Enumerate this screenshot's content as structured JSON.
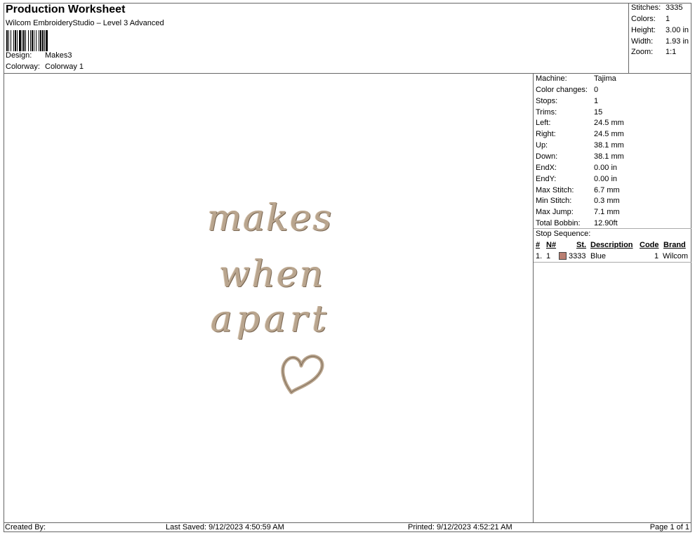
{
  "header": {
    "title": "Production Worksheet",
    "subtitle": "Wilcom EmbroideryStudio – Level 3 Advanced",
    "design_label": "Design:",
    "design_value": "Makes3",
    "colorway_label": "Colorway:",
    "colorway_value": "Colorway 1"
  },
  "summary": [
    {
      "label": "Stitches:",
      "value": "3335"
    },
    {
      "label": "Colors:",
      "value": "1"
    },
    {
      "label": "Height:",
      "value": "3.00 in"
    },
    {
      "label": "Width:",
      "value": "1.93 in"
    },
    {
      "label": "Zoom:",
      "value": "1:1"
    }
  ],
  "machine_info": [
    {
      "label": "Machine:",
      "value": "Tajima"
    },
    {
      "label": "Color changes:",
      "value": "0"
    },
    {
      "label": "Stops:",
      "value": "1"
    },
    {
      "label": "Trims:",
      "value": "15"
    },
    {
      "label": "Left:",
      "value": "24.5 mm"
    },
    {
      "label": "Right:",
      "value": "24.5 mm"
    },
    {
      "label": "Up:",
      "value": "38.1 mm"
    },
    {
      "label": "Down:",
      "value": "38.1 mm"
    },
    {
      "label": "EndX:",
      "value": "0.00 in"
    },
    {
      "label": "EndY:",
      "value": "0.00 in"
    },
    {
      "label": "Max Stitch:",
      "value": "6.7 mm"
    },
    {
      "label": "Min Stitch:",
      "value": "0.3 mm"
    },
    {
      "label": "Max Jump:",
      "value": "7.1 mm"
    },
    {
      "label": "Total Bobbin:",
      "value": "12.90ft"
    }
  ],
  "stop_sequence": {
    "title": "Stop Sequence:",
    "columns": [
      "#",
      "N#",
      "St.",
      "Description",
      "Code",
      "Brand"
    ],
    "rows": [
      {
        "num": "1.",
        "n": "1",
        "color": "#b97f72",
        "stitches": "3333",
        "description": "Blue",
        "code": "1",
        "brand": "Wilcom"
      }
    ]
  },
  "design": {
    "lines": [
      "makes",
      "when",
      "apart"
    ],
    "thread_color": "#b9a58e"
  },
  "footer": {
    "created_by": "Created By:",
    "last_saved": "Last Saved: 9/12/2023 4:50:59 AM",
    "printed": "Printed: 9/12/2023 4:52:21 AM",
    "page": "Page 1 of 1"
  }
}
